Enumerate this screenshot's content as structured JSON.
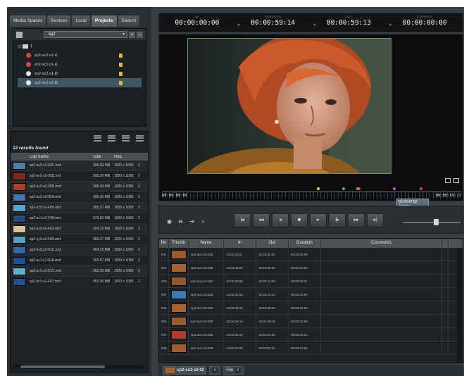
{
  "left_panel": {
    "tabs": [
      "Media Spaces",
      "Devices",
      "Local",
      "Projects",
      "Search"
    ],
    "active_tab": "Projects",
    "project_select": "sp2",
    "tree": {
      "root_label": "1",
      "items": [
        {
          "name": "sp2-sc2-s1-t1",
          "status_color": "#d9473c"
        },
        {
          "name": "sp2-sc2-s1-t2",
          "status_color": "#d9473c"
        },
        {
          "name": "sp2-sc2-s1-t3",
          "status_color": "#e9ecee"
        },
        {
          "name": "sp2-sc2-s2-t2",
          "status_color": "#e9ecee",
          "selected": true
        }
      ]
    },
    "results_label": "12 results found",
    "columns": [
      "Clip name",
      "Size",
      "Res."
    ],
    "clips": [
      {
        "name": "sp2-sc2-s2-03C.mxf",
        "size": "306.30 MB",
        "res": "1920 x 1080",
        "thumb": "#4d7ea6"
      },
      {
        "name": "sp2-sc2-s2-03D.mxf",
        "size": "306.30 MB",
        "res": "1920 x 1080",
        "thumb": "#7a2a1f"
      },
      {
        "name": "sp2-sc2-s2-05D.mxf",
        "size": "306.30 MB",
        "res": "1920 x 1080",
        "thumb": "#b13c2c"
      },
      {
        "name": "sp2-sc2-s2-02A.mxf",
        "size": "306.30 MB",
        "res": "1920 x 1080",
        "thumb": "#3f78b8"
      },
      {
        "name": "sp2-sc2-s2-F06.mxf",
        "size": "383.37 MB",
        "res": "1920 x 1080",
        "thumb": "#52a8c8"
      },
      {
        "name": "sp2-sc1-s1-F08.mxf",
        "size": "373.63 MB",
        "res": "1920 x 1080",
        "thumb": "#2c4a7a"
      },
      {
        "name": "sp2-sc2-s2-F03.mxf",
        "size": "304.15 MB",
        "res": "1920 x 1080",
        "thumb": "#d6c58e"
      },
      {
        "name": "sp2-sc2-s2-F05.mxf",
        "size": "383.37 MB",
        "res": "1920 x 1080",
        "thumb": "#4fa6c4"
      },
      {
        "name": "sp2-sc2-s2-01C.mxf",
        "size": "304.15 MB",
        "res": "1920 x 1080",
        "thumb": "#3966a8"
      },
      {
        "name": "sp2-sc1-s1-01A.mxf",
        "size": "363.07 MB",
        "res": "1920 x 1080",
        "thumb": "#1e4f94"
      },
      {
        "name": "sp2-sc1-s1-01C.mxf",
        "size": "363.30 MB",
        "res": "1920 x 1080",
        "thumb": "#58b0cc"
      },
      {
        "name": "sp2-sc1-s1-F02.mxf",
        "size": "363.30 MB",
        "res": "1920 x 1080",
        "thumb": "#23508c"
      }
    ]
  },
  "timecodes": [
    {
      "label": "IN",
      "value": "00:00:00:00"
    },
    {
      "label": "DURATION",
      "value": "00:00:59:14"
    },
    {
      "label": "OUT",
      "value": "00:00:59:13"
    },
    {
      "label": "CURRENT",
      "value": "00:00:00:00"
    }
  ],
  "viewer": {
    "tc_start": "00:00:00:00",
    "tc_end": "00:00:59:13",
    "tooltip_tc": "00:00:47:02",
    "tooltip_name": "Jeremy",
    "markers": [
      "#d8d24a",
      "#58c24e",
      "#4ec05a",
      "#d94b3c",
      "#c94bc9",
      "#d94b3c"
    ]
  },
  "transport": {
    "buttons": [
      "|◂",
      "◂◂",
      "◂",
      "■",
      "▸",
      "|▸",
      "▸▸",
      "▸|"
    ]
  },
  "table": {
    "columns": [
      "No",
      "Thumb",
      "Name",
      "In",
      "Out",
      "Duration",
      "Comments"
    ],
    "rows": [
      {
        "no": "001",
        "name": "sp2-sc2-s2-03D",
        "in": "10:04:23:01",
        "out": "10:04:34:00",
        "dur": "00:00:00:00",
        "thumb": "#9c5a2c"
      },
      {
        "no": "002",
        "name": "sp2-sc2-s2-03D",
        "in": "10:04:34:04",
        "out": "10:04:38:00",
        "dur": "00:00:03:00",
        "thumb": "#a5622e"
      },
      {
        "no": "003",
        "name": "sp2-sc2-s2-03C",
        "in": "10:04:38:00",
        "out": "10:04:42:04",
        "dur": "00:00:02:21",
        "thumb": "#8e5a33"
      },
      {
        "no": "004",
        "name": "sp2-sc2-s2-03D",
        "in": "10:04:42:05",
        "out": "10:04:44:10",
        "dur": "00:00:02:06",
        "thumb": "#3f78b8"
      },
      {
        "no": "005",
        "name": "sp2-sc2-s2-03D",
        "in": "10:04:44:10",
        "out": "10:04:46:09",
        "dur": "00:00:01:22",
        "thumb": "#a8622f"
      },
      {
        "no": "006",
        "name": "sp2-sc2-s2-03D",
        "in": "10:04:46:10",
        "out": "10:04:49:16",
        "dur": "00:00:02:06",
        "thumb": "#9a5a2e"
      },
      {
        "no": "007",
        "name": "sp2-sc2-s2-03D",
        "in": "10:04:49:10",
        "out": "10:04:51:09",
        "dur": "00:00:01:12",
        "thumb": "#b13c2c"
      },
      {
        "no": "008",
        "name": "sp2-sc2-s2-03D",
        "in": "10:04:51:09",
        "out": "10:04:53:03",
        "dur": "00:00:01:26",
        "thumb": "#a05c2c"
      }
    ]
  },
  "bottom_tabs": [
    {
      "label": "sp2-sc2-s2-t2",
      "active": true
    },
    {
      "label": "File",
      "active": false
    }
  ]
}
